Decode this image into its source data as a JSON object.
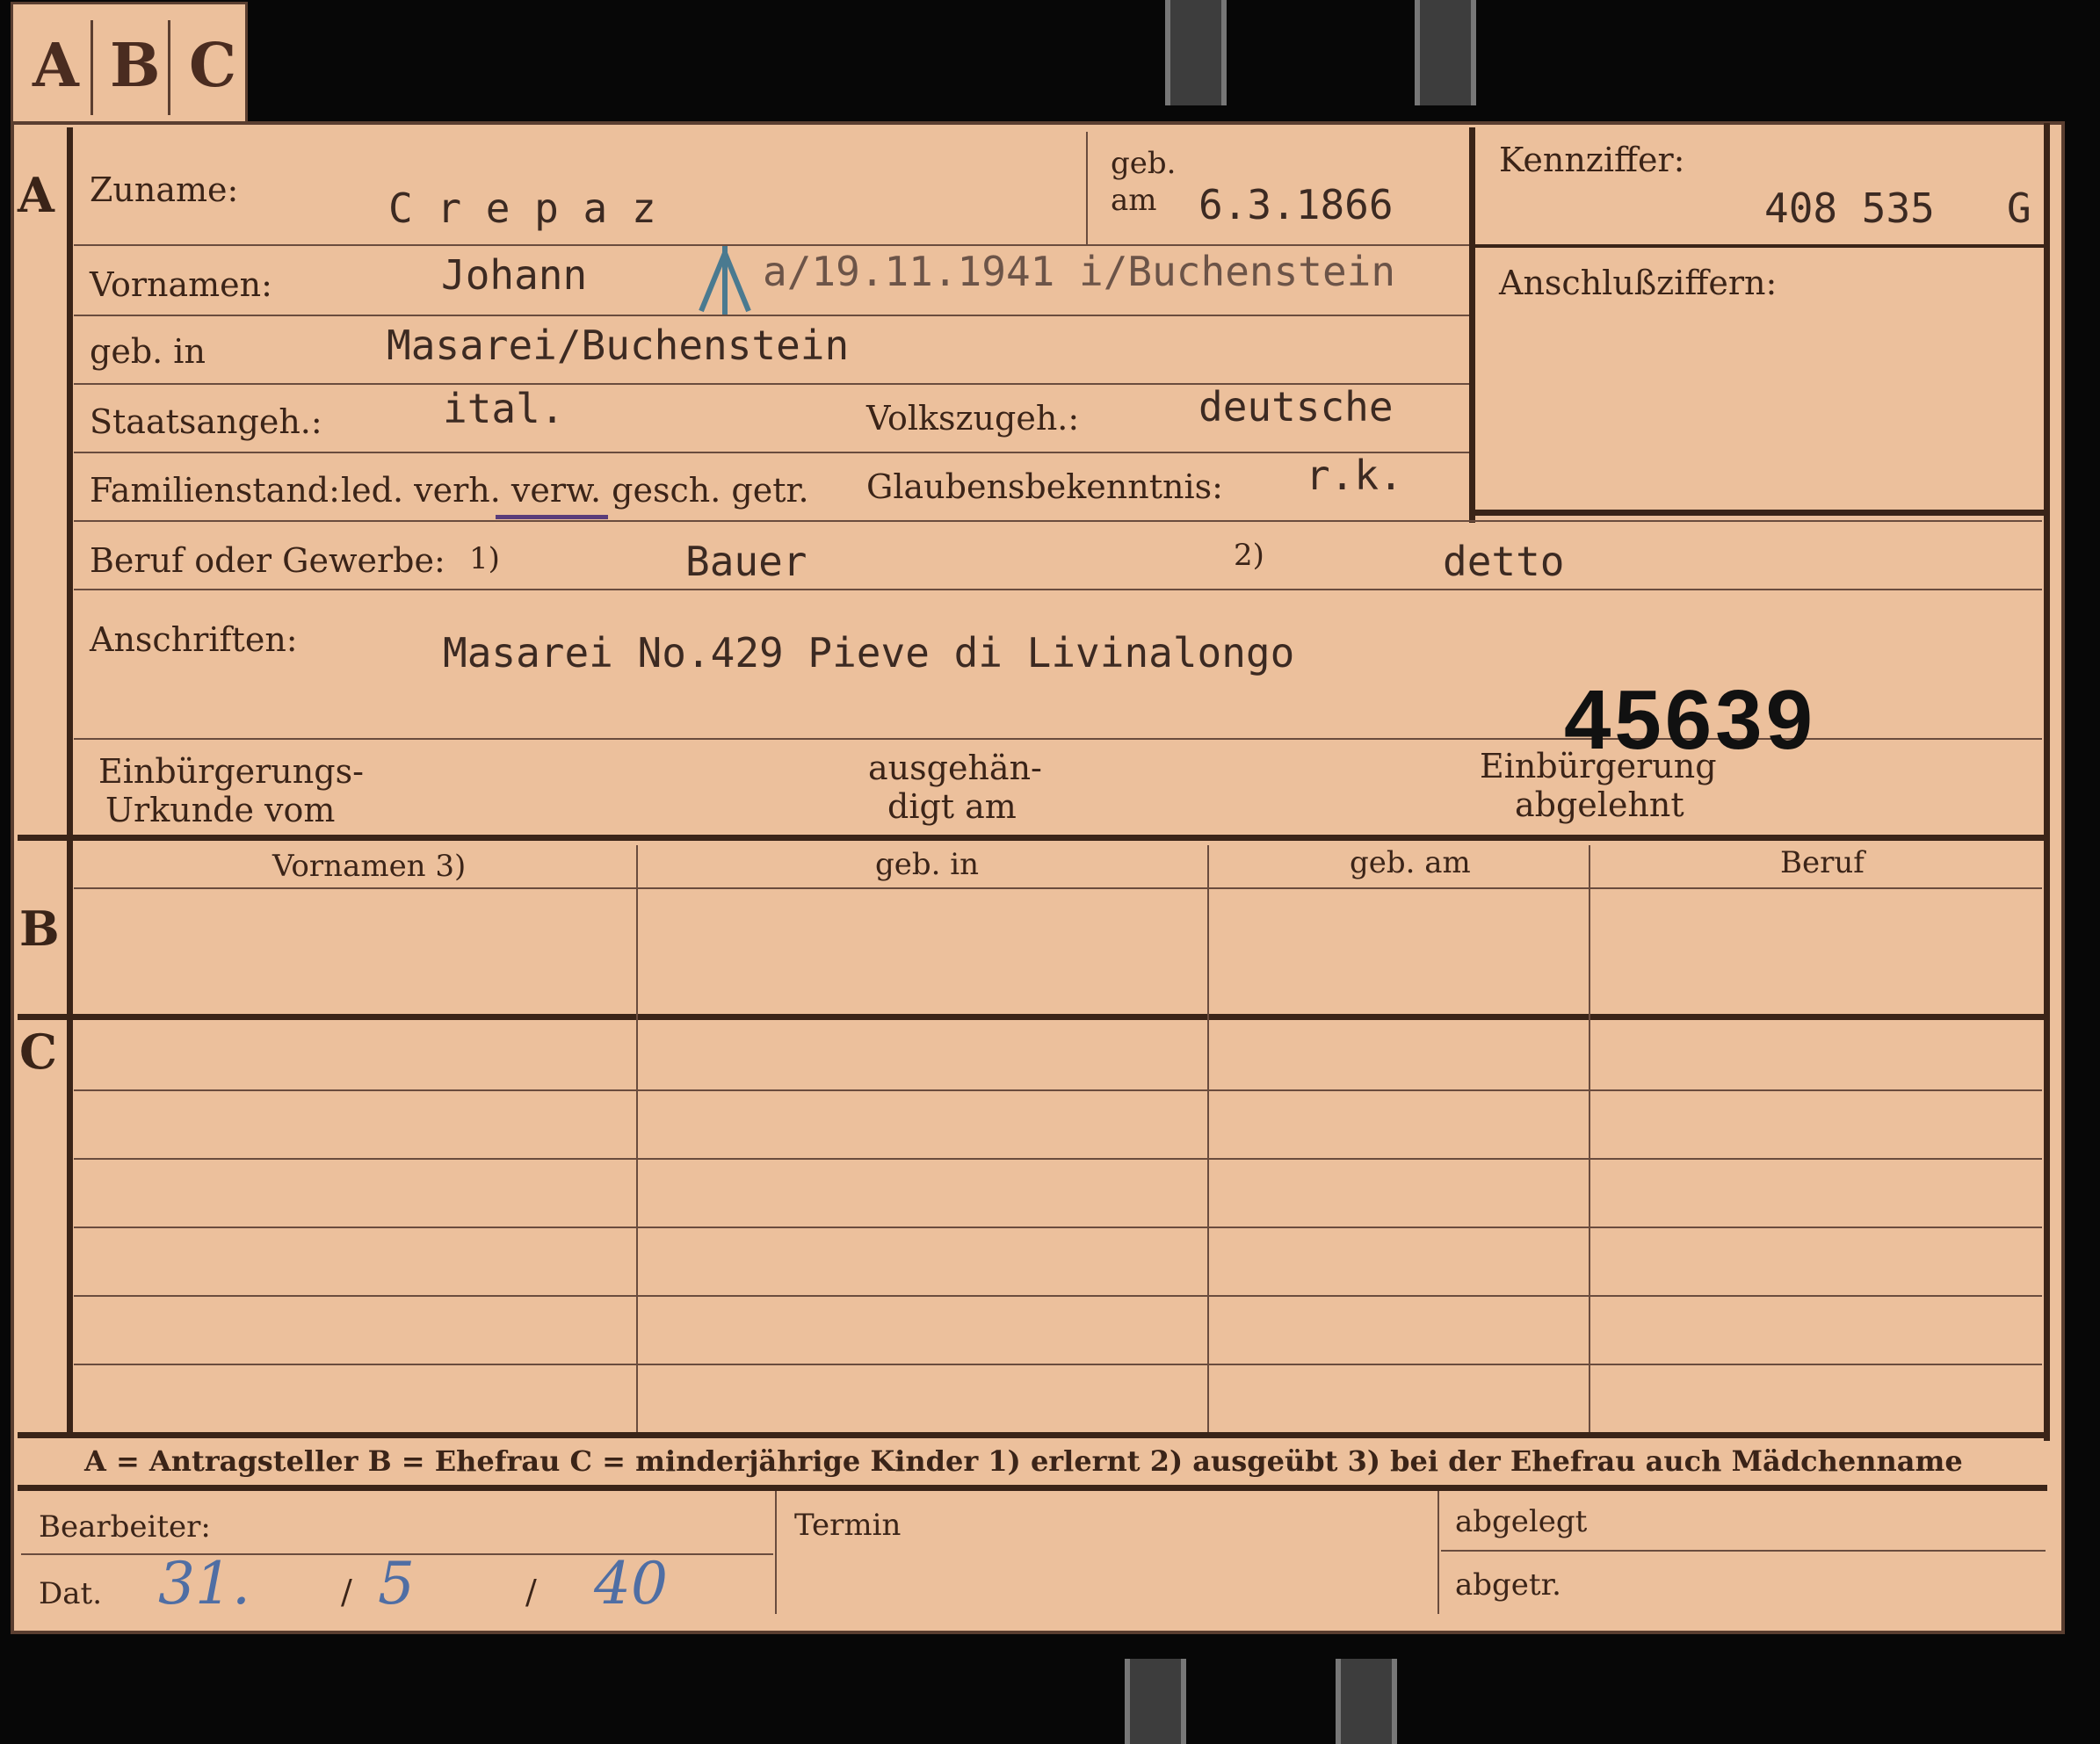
{
  "tabs": [
    "A",
    "B",
    "C"
  ],
  "sections": {
    "a": "A",
    "b": "B",
    "c": "C"
  },
  "labels": {
    "zuname": "Zuname:",
    "geb": "geb.",
    "am": "am",
    "kennziffer": "Kennziffer:",
    "vornamen": "Vornamen:",
    "anschlussziffern": "Anschlußziffern:",
    "geb_in": "geb. in",
    "staatsangeh": "Staatsangeh.:",
    "volkszugeh": "Volkszugeh.:",
    "familienstand": "Familienstand:",
    "familienstand_options": "led. verh. verw. gesch. getr.",
    "glaubensbekenntnis": "Glaubensbekenntnis:",
    "beruf": "Beruf oder Gewerbe:",
    "beruf_note1": "1)",
    "beruf_note2": "2)",
    "anschriften": "Anschriften:",
    "einbuergerung_urkunde_1": "Einbürgerungs-",
    "einbuergerung_urkunde_2": "Urkunde vom",
    "ausgehaendigt_1": "ausgehän-",
    "ausgehaendigt_2": "digt am",
    "einbuergerung_abgelehnt_1": "Einbürgerung",
    "einbuergerung_abgelehnt_2": "abgelehnt",
    "col_vornamen": "Vornamen 3)",
    "col_geb_in": "geb. in",
    "col_geb_am": "geb. am",
    "col_beruf": "Beruf",
    "legend": "A = Antragsteller    B = Ehefrau    C = minderjährige Kinder    1) erlernt    2) ausgeübt    3) bei der Ehefrau auch Mädchenname",
    "bearbeiter": "Bearbeiter:",
    "dat": "Dat.",
    "termin": "Termin",
    "abgelegt": "abgelegt",
    "abgetr": "abgetr."
  },
  "values": {
    "zuname": "C r e p a z",
    "geb_am": "6.3.1866",
    "kennziffer": "408 535",
    "kennziffer_suffix": "G",
    "vornamen": "Johann",
    "death_mark": "a/19.11.1941 i/Buchenstein",
    "geb_in": "Masarei/Buchenstein",
    "staatsangeh": "ital.",
    "volkszugeh": "deutsche",
    "glaubensbekenntnis": "r.k.",
    "beruf_erlernt": "Bauer",
    "beruf_ausgeuebt": "detto",
    "anschrift": "Masarei No.429 Pieve di Livinalongo",
    "stamp_number": "45639",
    "datum_day": "31.",
    "datum_month": "5",
    "datum_year": "40"
  },
  "colors": {
    "card": "#ecc09c",
    "ink": "#3a2418",
    "handwriting": "#4f6ea4",
    "background": "#070707"
  }
}
